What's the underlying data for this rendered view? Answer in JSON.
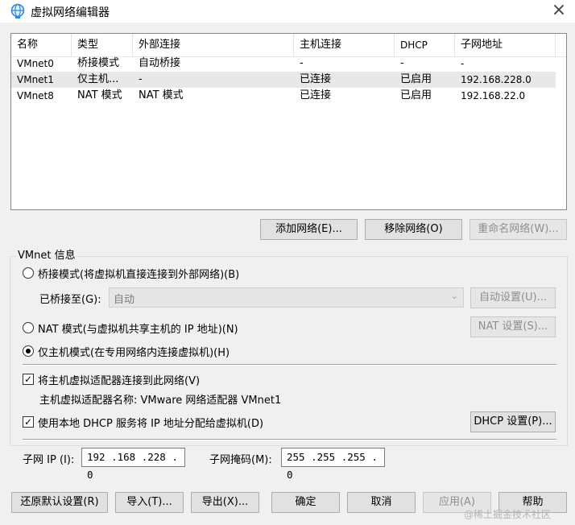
{
  "window": {
    "title": "虚拟网络编辑器",
    "close": "×"
  },
  "network_list": {
    "columns": [
      "名称",
      "类型",
      "外部连接",
      "主机连接",
      "DHCP",
      "子网地址"
    ],
    "rows": [
      {
        "name": "VMnet0",
        "type": "桥接模式",
        "external": "自动桥接",
        "host": "-",
        "dhcp": "-",
        "subnet": "-"
      },
      {
        "name": "VMnet1",
        "type": "仅主机...",
        "external": "-",
        "host": "已连接",
        "dhcp": "已启用",
        "subnet": "192.168.228.0"
      },
      {
        "name": "VMnet8",
        "type": "NAT 模式",
        "external": "NAT 模式",
        "host": "已连接",
        "dhcp": "已启用",
        "subnet": "192.168.22.0"
      }
    ],
    "selected_row": 1
  },
  "list_buttons": {
    "add": "添加网络(E)...",
    "remove": "移除网络(O)",
    "rename": "重命名网络(W)..."
  },
  "vmnet_info": {
    "group_label": "VMnet 信息",
    "bridge_radio": "桥接模式(将虚拟机直接连接到外部网络)(B)",
    "bridged_to_label": "已桥接至(G):",
    "bridged_to_value": "自动",
    "auto_settings": "自动设置(U)...",
    "nat_radio": "NAT 模式(与虚拟机共享主机的 IP 地址)(N)",
    "nat_settings": "NAT 设置(S)...",
    "hostonly_radio": "仅主机模式(在专用网络内连接虚拟机)(H)",
    "selected_mode": "hostonly",
    "connect_adapter_check": "将主机虚拟适配器连接到此网络(V)",
    "connect_adapter_checked": true,
    "adapter_name": "主机虚拟适配器名称: VMware 网络适配器 VMnet1",
    "dhcp_check": "使用本地 DHCP 服务将 IP 地址分配给虚拟机(D)",
    "dhcp_checked": true,
    "dhcp_settings": "DHCP 设置(P)...",
    "subnet_ip_label": "子网 IP (I):",
    "subnet_ip": "192 .168 .228 .  0",
    "subnet_mask_label": "子网掩码(M):",
    "subnet_mask": "255 .255 .255 .  0"
  },
  "bottom_buttons": {
    "restore": "还原默认设置(R)",
    "import": "导入(T)...",
    "export": "导出(X)...",
    "ok": "确定",
    "cancel": "取消",
    "apply": "应用(A)",
    "help": "帮助"
  },
  "watermark": "@稀土掘金技术社区",
  "colors": {
    "selected_row": "#e8e8e8",
    "button_face": "#e1e1e1",
    "title_icon": "#2e86de"
  }
}
